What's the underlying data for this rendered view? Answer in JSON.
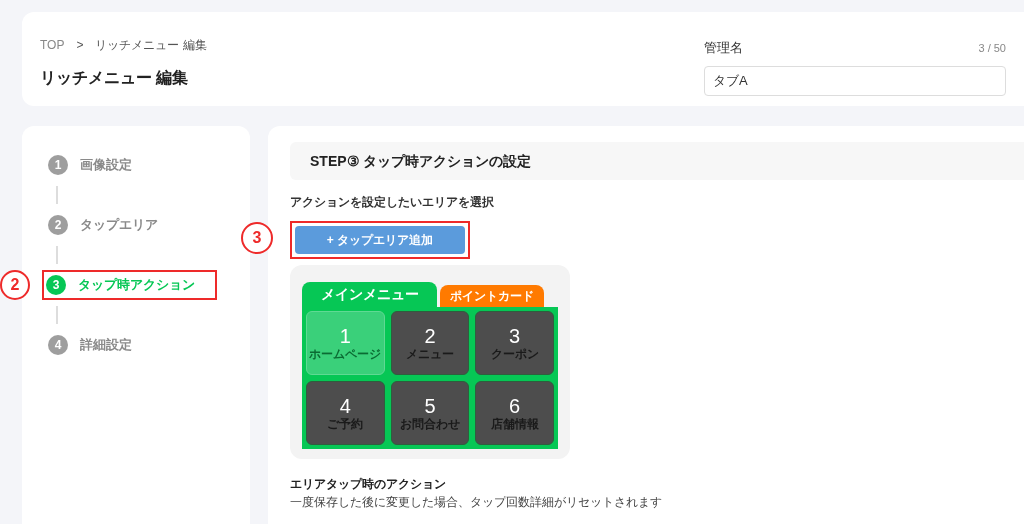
{
  "header": {
    "breadcrumb": [
      "TOP",
      "リッチメニュー 編集"
    ],
    "breadcrumb_separator": ">",
    "title": "リッチメニュー 編集",
    "manage_name": {
      "label": "管理名",
      "counter": "3 / 50",
      "value": "タブA"
    }
  },
  "steps": [
    {
      "number": "1",
      "label": "画像設定",
      "selected": false
    },
    {
      "number": "2",
      "label": "タップエリア",
      "selected": false
    },
    {
      "number": "3",
      "label": "タップ時アクション",
      "selected": true,
      "annotation": "2"
    },
    {
      "number": "4",
      "label": "詳細設定",
      "selected": false
    }
  ],
  "main": {
    "section_title": "STEP③ タップ時アクションの設定",
    "instruction": "アクションを設定したいエリアを選択",
    "add_button": {
      "label": "+ タップエリア追加",
      "annotation": "3"
    },
    "rich_menu": {
      "tabs": [
        {
          "label": "メインメニュー",
          "selected": true,
          "color": "#06c755"
        },
        {
          "label": "ポイントカード",
          "selected": false,
          "color": "#ff7a00"
        }
      ],
      "cells": [
        {
          "number": "1",
          "label": "ホームページ",
          "selected": true
        },
        {
          "number": "2",
          "label": "メニュー",
          "selected": false
        },
        {
          "number": "3",
          "label": "クーポン",
          "selected": false
        },
        {
          "number": "4",
          "label": "ご予約",
          "selected": false
        },
        {
          "number": "5",
          "label": "お問合わせ",
          "selected": false
        },
        {
          "number": "6",
          "label": "店舗情報",
          "selected": false
        }
      ]
    },
    "footer_heading": "エリアタップ時のアクション",
    "footer_note": "一度保存した後に変更した場合、タップ回数詳細がリセットされます"
  }
}
